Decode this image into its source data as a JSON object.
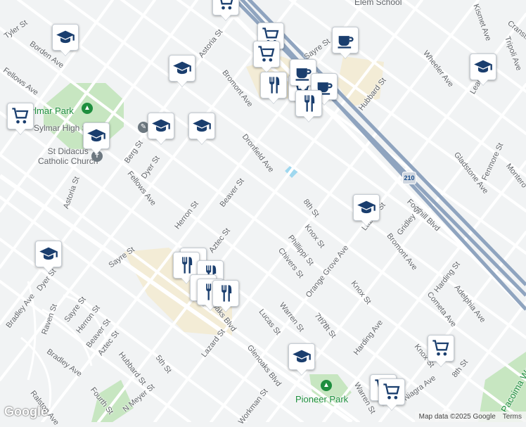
{
  "map": {
    "attribution": "Map data ©2025 Google",
    "terms": "Terms",
    "logo": "Google",
    "highway_shield": "210",
    "colors": {
      "background": "#f1f3f4",
      "road": "#ffffff",
      "highway": "#8fa4bf",
      "park": "#c7e6c1",
      "campus": "#f3ecd6",
      "water": "#9fd8ef",
      "marker_icon": "#1a3e6e"
    }
  },
  "places": {
    "sylmar_park": "Sylmar Park",
    "sylmar_hs": "Sylmar High School",
    "st_didacus": "St Didacus\nCatholic Church",
    "pioneer_park": "Pioneer Park",
    "elem_school": "Elem School",
    "pacoima_wash": "Pacoima Wash"
  },
  "streets": [
    "Tyler St",
    "Borden Ave",
    "Fellows Ave",
    "Astoria St",
    "Bromont Ave",
    "Sayre St",
    "Hubbard St",
    "Dronfield Ave",
    "Berg St",
    "Dyer St",
    "Fellows Ave",
    "Herron St",
    "Beaver St",
    "Aztec St",
    "8th St",
    "Knox St",
    "Phillippi St",
    "Chivers St",
    "Orange Grove Ave",
    "Warren St",
    "Lucas St",
    "Glenoaks Blvd",
    "Glenoaks Blvd",
    "Lazard St",
    "5th St",
    "Hubbard St",
    "Fourth St",
    "N Meyer St",
    "Bradley Ave",
    "Bradley Ave",
    "Raven St",
    "Sayre St",
    "Herron St",
    "Beaver St",
    "Aztec St",
    "Dyer St",
    "Ralston Ave",
    "Workman St",
    "7th St",
    "Harding Ave",
    "Knox St",
    "Foothill Blvd",
    "Gridley St",
    "Bromont Ave",
    "Harding St",
    "Adelphia Ave",
    "Cometa Ave",
    "Knox St",
    "8th St",
    "Gladstone Ave",
    "Fenmore St",
    "Montero",
    "Wheeler Ave",
    "Leach",
    "Kismet Ave",
    "Tripoli Ave",
    "Cranston",
    "Lazard St",
    "Astoria St",
    "Sayre St",
    "Warren St",
    "Niagra Ave",
    "7th St",
    "Lazard St",
    "N Meyer St"
  ],
  "markers": [
    {
      "type": "school",
      "icon": "school-icon"
    },
    {
      "type": "school",
      "icon": "school-icon"
    },
    {
      "type": "school",
      "icon": "school-icon"
    },
    {
      "type": "school",
      "icon": "school-icon"
    },
    {
      "type": "school",
      "icon": "school-icon"
    },
    {
      "type": "school",
      "icon": "school-icon"
    },
    {
      "type": "school",
      "icon": "school-icon"
    },
    {
      "type": "school",
      "icon": "school-icon"
    },
    {
      "type": "grocery",
      "icon": "shopping-cart-icon"
    },
    {
      "type": "grocery",
      "icon": "shopping-cart-icon"
    },
    {
      "type": "grocery",
      "icon": "shopping-cart-icon"
    },
    {
      "type": "grocery",
      "icon": "shopping-cart-icon"
    },
    {
      "type": "grocery",
      "icon": "shopping-cart-icon"
    },
    {
      "type": "grocery",
      "icon": "shopping-cart-icon"
    },
    {
      "type": "grocery",
      "icon": "shopping-cart-icon"
    },
    {
      "type": "grocery",
      "icon": "shopping-cart-icon"
    },
    {
      "type": "cafe",
      "icon": "coffee-cup-icon"
    },
    {
      "type": "cafe",
      "icon": "coffee-cup-icon"
    },
    {
      "type": "cafe",
      "icon": "coffee-cup-icon"
    },
    {
      "type": "restaurant",
      "icon": "fork-knife-icon"
    },
    {
      "type": "restaurant",
      "icon": "fork-knife-icon"
    },
    {
      "type": "restaurant",
      "icon": "fork-knife-icon"
    },
    {
      "type": "restaurant",
      "icon": "fork-knife-icon"
    },
    {
      "type": "restaurant",
      "icon": "fork-knife-icon"
    },
    {
      "type": "restaurant",
      "icon": "fork-knife-icon"
    },
    {
      "type": "restaurant",
      "icon": "fork-knife-icon"
    },
    {
      "type": "restaurant",
      "icon": "fork-knife-icon"
    }
  ]
}
